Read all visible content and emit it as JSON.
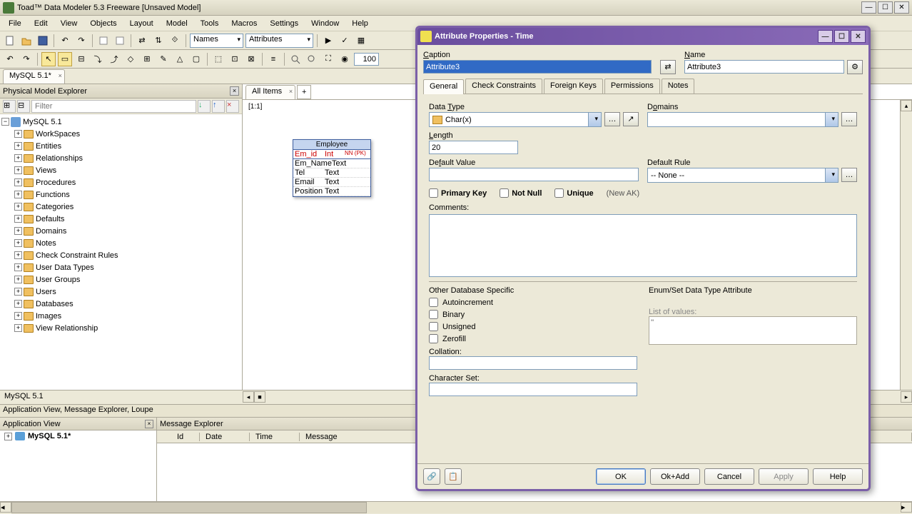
{
  "app": {
    "title": "Toad™ Data Modeler 5.3 Freeware  [Unsaved Model]"
  },
  "menus": [
    "File",
    "Edit",
    "View",
    "Objects",
    "Layout",
    "Model",
    "Tools",
    "Macros",
    "Settings",
    "Window",
    "Help"
  ],
  "toolbar1": {
    "combo_names": "Names",
    "combo_attrs": "Attributes",
    "zoom_value": "100"
  },
  "tabs": {
    "doc_tab": "MySQL 5.1*"
  },
  "explorer": {
    "title": "Physical Model Explorer",
    "filter_placeholder": "Filter",
    "root": "MySQL 5.1",
    "items": [
      "WorkSpaces",
      "Entities",
      "Relationships",
      "Views",
      "Procedures",
      "Functions",
      "Categories",
      "Defaults",
      "Domains",
      "Notes",
      "Check Constraint Rules",
      "User Data Types",
      "User Groups",
      "Users",
      "Databases",
      "Images",
      "View Relationship"
    ]
  },
  "designer": {
    "all_items_tab": "All Items",
    "zoom_label": "[1:1]",
    "entity": {
      "name": "Employee",
      "cols": [
        {
          "name": "Em_id",
          "type": "Int",
          "flags": "NN  (PK)"
        },
        {
          "name": "Em_Name",
          "type": "Text",
          "flags": ""
        },
        {
          "name": "Tel",
          "type": "Text",
          "flags": ""
        },
        {
          "name": "Email",
          "type": "Text",
          "flags": ""
        },
        {
          "name": "Position",
          "type": "Text",
          "flags": ""
        }
      ]
    }
  },
  "status": "MySQL 5.1",
  "bottom_tabs_label": "Application View, Message Explorer, Loupe",
  "app_view": {
    "title": "Application View",
    "item": "MySQL 5.1*"
  },
  "msg_explorer": {
    "title": "Message Explorer",
    "cols": [
      "Id",
      "Date",
      "Time",
      "Message"
    ]
  },
  "dialog": {
    "title": "Attribute Properties - Time",
    "caption_label": "Caption",
    "caption_value": "Attribute3",
    "name_label": "Name",
    "name_value": "Attribute3",
    "tabs": [
      "General",
      "Check Constraints",
      "Foreign Keys",
      "Permissions",
      "Notes"
    ],
    "data_type_label": "Data Type",
    "data_type_value": "Char(x)",
    "domains_label": "Domains",
    "domains_value": "",
    "length_label": "Length",
    "length_value": "20",
    "default_value_label": "Default Value",
    "default_value_value": "",
    "default_rule_label": "Default Rule",
    "default_rule_value": "-- None --",
    "pk_label": "Primary Key",
    "nn_label": "Not Null",
    "unique_label": "Unique",
    "new_ak_label": "(New AK)",
    "comments_label": "Comments:",
    "other_db_label": "Other Database Specific",
    "autoincrement": "Autoincrement",
    "binary": "Binary",
    "unsigned": "Unsigned",
    "zerofill": "Zerofill",
    "collation_label": "Collation:",
    "charset_label": "Character Set:",
    "enum_label": "Enum/Set Data Type Attribute",
    "list_label": "List of values:",
    "list_value": "''",
    "btn_ok": "OK",
    "btn_okadd": "Ok+Add",
    "btn_cancel": "Cancel",
    "btn_apply": "Apply",
    "btn_help": "Help"
  }
}
